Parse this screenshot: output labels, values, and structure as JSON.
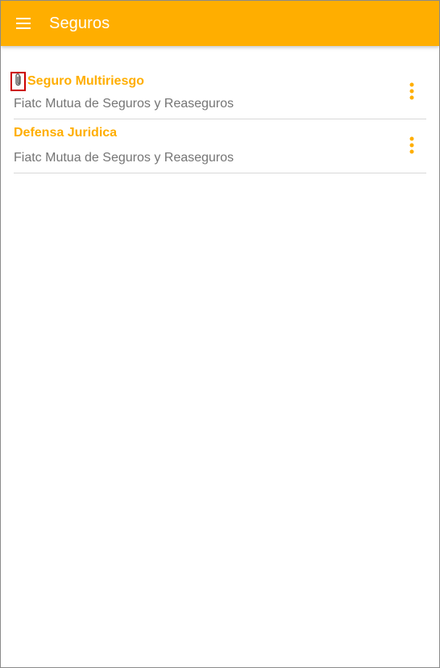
{
  "colors": {
    "accent": "#FFAE00",
    "title_text": "#FFFFFF",
    "subtitle_text": "#757575",
    "divider": "#D9D9D9",
    "highlight_box": "#CC0000"
  },
  "appbar": {
    "menu_icon": "menu-icon",
    "title": "Seguros"
  },
  "policies": [
    {
      "title": "Seguro Multiriesgo",
      "subtitle": "Fiatc Mutua de Seguros y Reaseguros",
      "has_attachment": true,
      "attachment_icon": "paperclip-icon",
      "more_icon": "more-vert-icon"
    },
    {
      "title": "Defensa Juridica",
      "subtitle": "Fiatc Mutua de Seguros y Reaseguros",
      "has_attachment": false,
      "more_icon": "more-vert-icon"
    }
  ]
}
